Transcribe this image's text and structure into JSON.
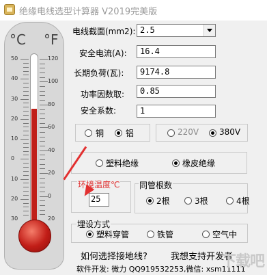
{
  "window": {
    "title": "绝缘电线选型计算器 V2019完美版"
  },
  "thermometer": {
    "unit_c": "°C",
    "unit_f": "°F",
    "celsius_ticks": [
      "50",
      "40",
      "30",
      "20",
      "10",
      "0",
      "10",
      "20",
      "30"
    ],
    "fahrenheit_ticks": [
      "120",
      "100",
      "80",
      "60",
      "40",
      "20",
      "0",
      "20"
    ],
    "mercury_level_c": 25
  },
  "form": {
    "cross_section_label": "电线截面(mm2):",
    "cross_section_value": "2.5",
    "safe_current_label": "安全电流(A):",
    "safe_current_value": "16.4",
    "long_load_label": "长期负荷(瓦):",
    "long_load_value": "9174.8",
    "power_factor_label": "功率因数取:",
    "power_factor_value": "0.85",
    "safety_factor_label": "安全系数:",
    "safety_factor_value": "1"
  },
  "material": {
    "copper": "铜",
    "aluminum": "铝",
    "selected": "aluminum"
  },
  "voltage": {
    "v220": "220V",
    "v380": "380V",
    "selected": "380V"
  },
  "insulation": {
    "plastic": "塑料绝缘",
    "rubber": "橡皮绝缘",
    "selected": "rubber"
  },
  "ambient": {
    "label": "环境温度℃",
    "value": "25"
  },
  "conduit_count": {
    "label": "同管根数",
    "options": [
      "2根",
      "3根",
      "4根"
    ],
    "selected": "2根"
  },
  "laying": {
    "label": "埋设方式",
    "options": [
      "塑料穿管",
      "铁管",
      "空气中"
    ],
    "selected": "塑料穿管"
  },
  "footer": {
    "help_link": "如何选择接地线?",
    "support_link": "我想支持开发者",
    "developer": "软件开发: 微力 QQ919532253,微信: xsm11111"
  },
  "watermark": "下载吧"
}
